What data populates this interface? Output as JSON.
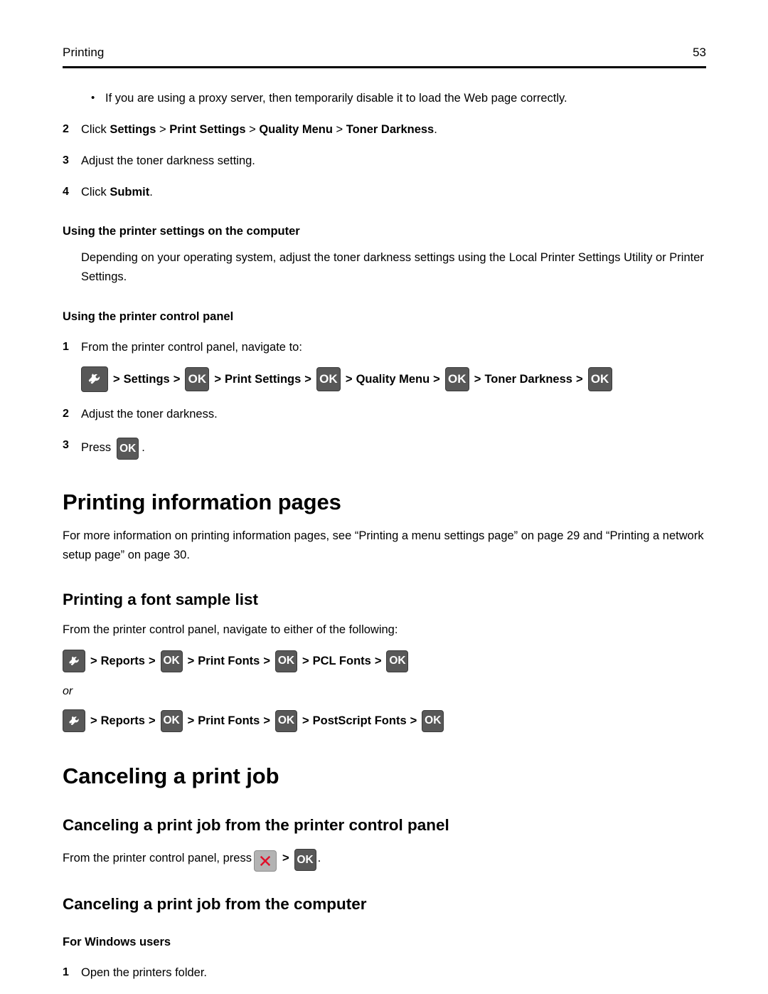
{
  "header": {
    "title": "Printing",
    "page_number": "53"
  },
  "bullet": {
    "marker": "•",
    "text": "If you are using a proxy server, then temporarily disable it to load the Web page correctly."
  },
  "web_steps": [
    {
      "num": "2",
      "prefix": "Click ",
      "bold1": "Settings",
      "sep1": " > ",
      "bold2": "Print Settings",
      "sep2": " > ",
      "bold3": "Quality Menu",
      "sep3": " > ",
      "bold4": "Toner Darkness",
      "suffix": "."
    },
    {
      "num": "3",
      "text": "Adjust the toner darkness setting."
    },
    {
      "num": "4",
      "prefix": "Click ",
      "bold1": "Submit",
      "suffix": "."
    }
  ],
  "computer_section": {
    "heading": "Using the printer settings on the computer",
    "body": "Depending on your operating system, adjust the toner darkness settings using the Local Printer Settings Utility or Printer Settings."
  },
  "control_panel_section": {
    "heading": "Using the printer control panel",
    "step1_num": "1",
    "step1_text": "From the printer control panel, navigate to:",
    "nav_path": {
      "wrench_icon": "wrench-icon",
      "sep": ">",
      "ok_label": "OK",
      "items": [
        "Settings",
        "Print Settings",
        "Quality Menu",
        "Toner Darkness"
      ]
    },
    "step2_num": "2",
    "step2_text": "Adjust the toner darkness.",
    "step3_num": "3",
    "step3_prefix": "Press",
    "step3_key": "OK",
    "step3_suffix": "."
  },
  "info_pages": {
    "heading": "Printing information pages",
    "body": "For more information on printing information pages, see “Printing a menu settings page” on page 29 and “Printing a network setup page” on page 30."
  },
  "font_sample": {
    "heading": "Printing a font sample list",
    "body": "From the printer control panel, navigate to either of the following:",
    "path_a": {
      "wrench_icon": "wrench-icon",
      "sep": ">",
      "ok_label": "OK",
      "items": [
        "Reports",
        "Print Fonts",
        "PCL Fonts"
      ]
    },
    "or_label": "or",
    "path_b": {
      "wrench_icon": "wrench-icon",
      "sep": ">",
      "ok_label": "OK",
      "items": [
        "Reports",
        "Print Fonts",
        "PostScript Fonts"
      ]
    }
  },
  "cancel_job": {
    "heading": "Canceling a print job",
    "panel_heading": "Canceling a print job from the printer control panel",
    "panel_text_lead": "From the printer control panel, press",
    "stop_icon": "stop-x-icon",
    "sep": ">",
    "ok_label": "OK",
    "panel_text_trail": ".",
    "computer_heading": "Canceling a print job from the computer",
    "windows_heading": "For Windows users",
    "windows_step1_num": "1",
    "windows_step1_text": "Open the printers folder."
  },
  "colors": {
    "key_dark": "#585858",
    "key_light": "#b3b3b3",
    "stop_red": "#e0102a",
    "text": "#000000",
    "rule": "#000000"
  }
}
